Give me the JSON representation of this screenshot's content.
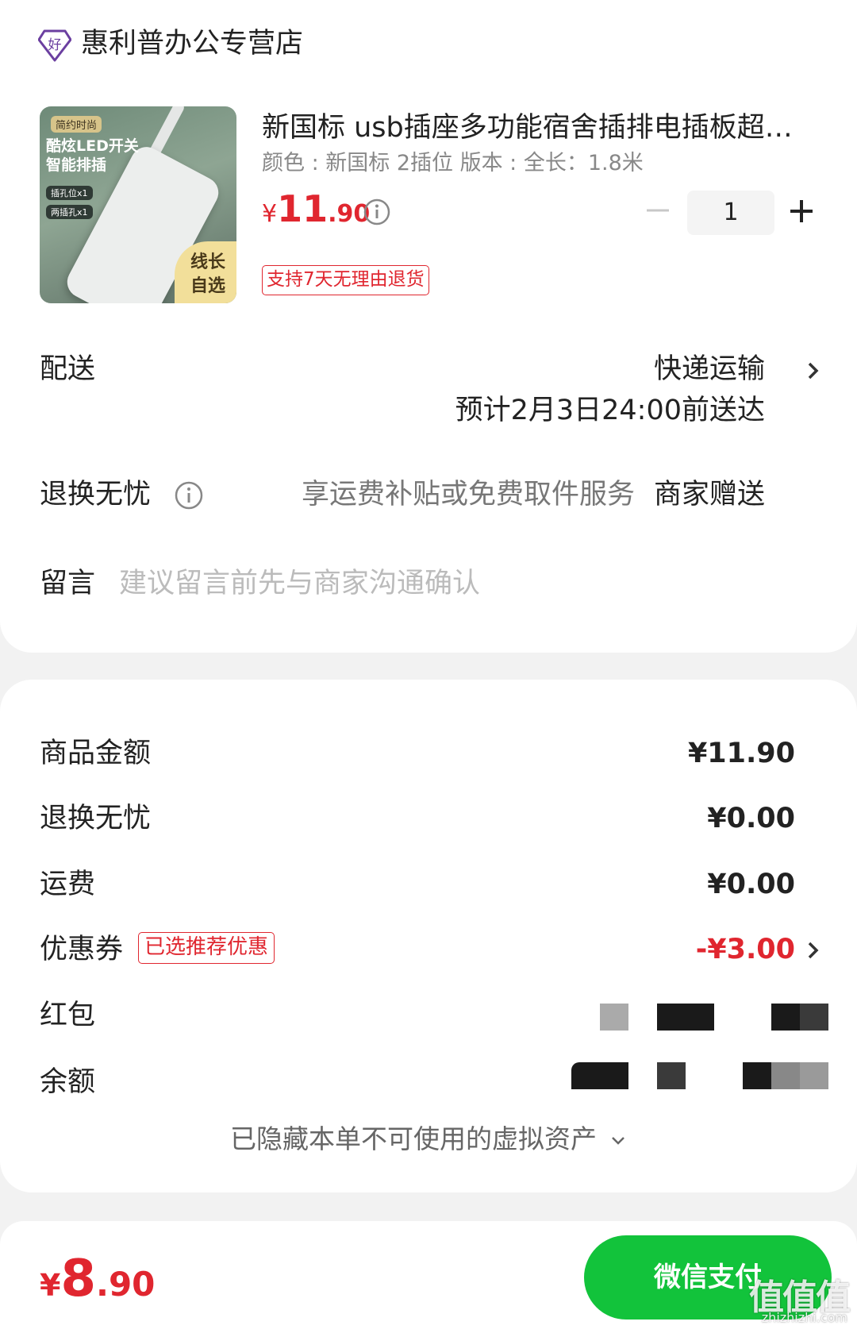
{
  "shop": {
    "name": "惠利普办公专营店",
    "icon": "diamond-good-icon",
    "icon_glyph": "好",
    "accent": "#6b3fa0"
  },
  "product": {
    "title": "新国标 usb插座多功能宿舍插排电插板超…",
    "spec": "颜色 : 新国标 2插位    版本 : 全长：1.8米",
    "price_symbol": "¥",
    "price_int": "11",
    "price_dec": ".90",
    "quantity": "1",
    "return_policy": "支持7天无理由退货",
    "thumbnail": {
      "tag": "简约时尚",
      "headline_line1": "酷炫LED开关",
      "headline_line2": "智能排插",
      "chip1": "插孔位x1",
      "chip2": "两插孔x1",
      "badge_line1": "线长",
      "badge_line2": "自选"
    }
  },
  "delivery": {
    "label": "配送",
    "method": "快递运输",
    "eta": "预计2月3日24:00前送达"
  },
  "worry_free": {
    "label": "退换无忧",
    "desc": "享运费补贴或免费取件服务",
    "gift": "商家赠送"
  },
  "message": {
    "label": "留言",
    "placeholder": "建议留言前先与商家沟通确认"
  },
  "summary": {
    "goods_label": "商品金额",
    "goods_value": "¥11.90",
    "worry_label": "退换无忧",
    "worry_value": "¥0.00",
    "shipping_label": "运费",
    "shipping_value": "¥0.00",
    "coupon_label": "优惠券",
    "coupon_badge": "已选推荐优惠",
    "coupon_value": "-¥3.00",
    "redpacket_label": "红包",
    "balance_label": "余额",
    "hidden_assets": "已隐藏本单不可使用的虚拟资产"
  },
  "footer": {
    "total_symbol": "¥",
    "total_int": "8",
    "total_dec": ".90",
    "pay_label": "微信支付",
    "watermark": "值值值",
    "watermark_url": "zhizhizhi.com"
  },
  "colors": {
    "price_red": "#e0262f",
    "pay_green": "#12c33b"
  }
}
